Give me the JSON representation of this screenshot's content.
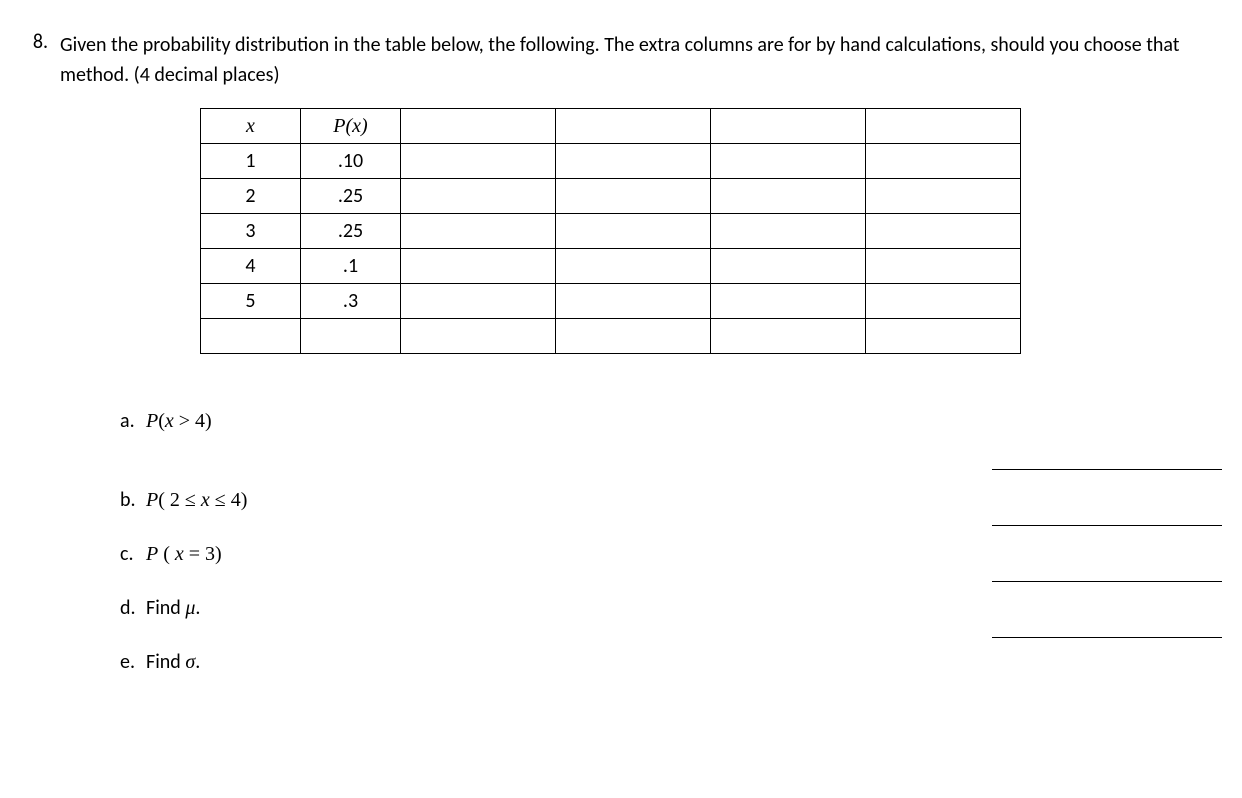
{
  "problem": {
    "number": "8.",
    "text": "Given the probability distribution in the table below, the following.  The extra columns are for by hand calculations, should you choose that method. (4 decimal places)"
  },
  "table": {
    "headers": {
      "col1": "x",
      "col2": "P(x)"
    },
    "rows": [
      {
        "x": "1",
        "px": ".10"
      },
      {
        "x": "2",
        "px": ".25"
      },
      {
        "x": "3",
        "px": ".25"
      },
      {
        "x": "4",
        "px": ".1"
      },
      {
        "x": "5",
        "px": ".3"
      }
    ]
  },
  "questions": {
    "a": {
      "letter": "a.",
      "text_prefix": "P",
      "text_expr": "(x > 4)"
    },
    "b": {
      "letter": "b.",
      "text_prefix": "P",
      "text_expr": "( 2 ≤ x ≤ 4)"
    },
    "c": {
      "letter": "c.",
      "text_prefix": "P",
      "text_expr": " ( x = 3)"
    },
    "d": {
      "letter": "d.",
      "text_plain": "Find ",
      "text_var": "μ",
      "text_suffix": "."
    },
    "e": {
      "letter": "e.",
      "text_plain": "Find ",
      "text_var": "σ",
      "text_suffix": "."
    }
  }
}
